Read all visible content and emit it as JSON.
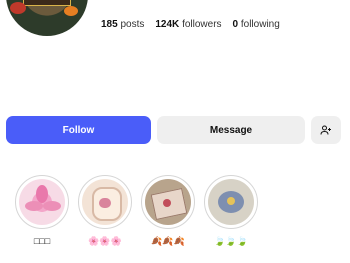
{
  "profile": {
    "stats": [
      {
        "value": "185",
        "label": "posts"
      },
      {
        "value": "124K",
        "label": "followers"
      },
      {
        "value": "0",
        "label": "following"
      }
    ]
  },
  "actions": {
    "follow_label": "Follow",
    "message_label": "Message",
    "add_icon": "person-add-icon"
  },
  "colors": {
    "follow_bg": "#4a5df9",
    "secondary_bg": "#efefef",
    "ring": "#d6d6d6"
  },
  "highlights": [
    {
      "label": "□□□"
    },
    {
      "label": "🌸🌸🌸"
    },
    {
      "label": "🍂🍂🍂"
    },
    {
      "label": "🍃🍃🍃"
    }
  ]
}
